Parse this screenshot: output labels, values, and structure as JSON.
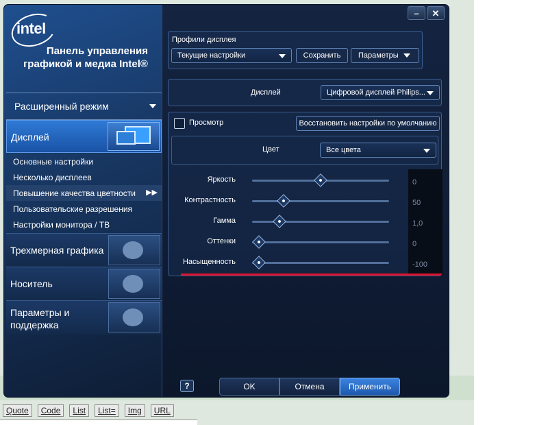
{
  "window": {
    "minimize_icon": "minimize-icon",
    "close_icon": "close-icon"
  },
  "sidebar": {
    "logo_text": "intel",
    "app_title": "Панель управления графикой и медиа Intel®",
    "mode": "Расширенный режим",
    "display_label": "Дисплей",
    "sub_items": [
      {
        "label": "Основные настройки"
      },
      {
        "label": "Несколько дисплеев"
      },
      {
        "label": "Повышение качества цветности",
        "active": true
      },
      {
        "label": "Пользовательские разрешения"
      },
      {
        "label": "Настройки монитора / ТВ"
      }
    ],
    "categories": [
      {
        "label": "Трехмерная графика"
      },
      {
        "label": "Носитель"
      },
      {
        "label": "Параметры и поддержка"
      }
    ]
  },
  "profiles": {
    "title": "Профили дисплея",
    "current": "Текущие настройки",
    "save": "Сохранить",
    "params": "Параметры"
  },
  "display": {
    "label": "Дисплей",
    "value": "Цифровой дисплей Philips..."
  },
  "preview": {
    "label": "Просмотр",
    "checked": false,
    "restore": "Восстановить настройки по умолчанию"
  },
  "color": {
    "label": "Цвет",
    "value": "Все цвета"
  },
  "sliders": [
    {
      "label": "Яркость",
      "value": "0",
      "fraction": 0.5
    },
    {
      "label": "Контрастность",
      "value": "50",
      "fraction": 0.23
    },
    {
      "label": "Гамма",
      "value": "1,0",
      "fraction": 0.2
    },
    {
      "label": "Оттенки",
      "value": "0",
      "fraction": 0.05
    },
    {
      "label": "Насыщенность",
      "value": "-100",
      "fraction": 0.05
    }
  ],
  "footer": {
    "help": "?",
    "ok": "OK",
    "cancel": "Отмена",
    "apply": "Применить"
  },
  "forum_buttons": [
    "Quote",
    "Code",
    "List",
    "List=",
    "Img",
    "URL"
  ],
  "colors": {
    "accent": "#2f7ad6",
    "highlight_line": "#e0102a"
  }
}
